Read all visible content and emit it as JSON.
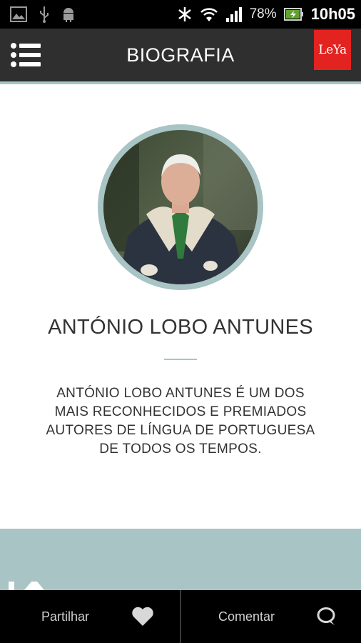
{
  "status_bar": {
    "battery_percent": "78%",
    "time": "10h05",
    "icons": [
      "image-icon",
      "usb-icon",
      "android-icon",
      "bluetooth-icon",
      "wifi-icon",
      "signal-icon",
      "battery-charging-icon"
    ]
  },
  "app_bar": {
    "title": "BIOGRAFIA",
    "logo_text": "LeYa",
    "logo_color": "#e32320"
  },
  "profile": {
    "name": "ANTÓNIO LOBO ANTUNES",
    "bio": "ANTÓNIO LOBO ANTUNES É UM DOS MAIS RECONHECIDOS E PREMIADOS AUTORES DE LÍNGUA DE PORTUGUESA DE TODOS OS TEMPOS."
  },
  "bottom_bar": {
    "share_label": "Partilhar",
    "comment_label": "Comentar",
    "share_icon": "heart-icon",
    "comment_icon": "speech-bubble-icon"
  },
  "colors": {
    "accent": "#a9c4c4",
    "app_bar_bg": "#2f2f2f",
    "bottom_bar_bg": "#000000"
  }
}
